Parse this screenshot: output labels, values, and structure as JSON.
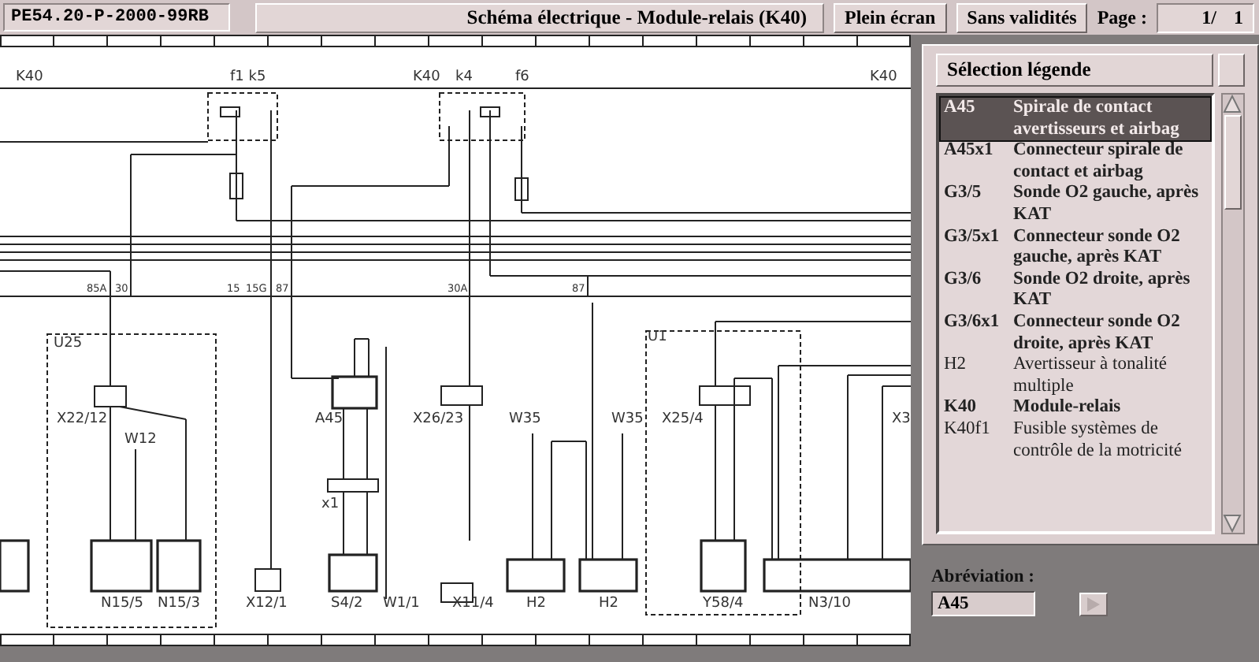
{
  "toolbar": {
    "document_id": "PE54.20-P-2000-99RB",
    "title": "Schéma électrique - Module-relais (K40)",
    "buttons": [
      "Plein écran",
      "Sans validités"
    ],
    "page_label": "Page :",
    "page_value": "1/ 1"
  },
  "diagram": {
    "labels": [
      "K40",
      "f1 k5",
      "K40",
      "k4",
      "f6",
      "K40",
      "85A",
      "30",
      "15",
      "15G",
      "87",
      "30A",
      "87",
      "U25",
      "X22/12",
      "W12",
      "N15/5",
      "N15/3",
      "X12/1",
      "A45",
      "x1",
      "S4/2",
      "W1/1",
      "X26/23",
      "X11/4",
      "W35",
      "W35",
      "H2",
      "H2",
      "U1",
      "X25/4",
      "Y58/4",
      "N3/10",
      "X3"
    ]
  },
  "legend": {
    "header": "Sélection légende",
    "items": [
      {
        "code": "A45",
        "description": "Spirale de contact avertisseurs et airbag",
        "selected": true,
        "bold": true
      },
      {
        "code": "A45x1",
        "description": "Connecteur spirale de contact et airbag",
        "selected": false,
        "bold": true
      },
      {
        "code": "G3/5",
        "description": "Sonde O2 gauche, après KAT",
        "selected": false,
        "bold": true
      },
      {
        "code": "G3/5x1",
        "description": "Connecteur sonde O2 gauche, après KAT",
        "selected": false,
        "bold": true
      },
      {
        "code": "G3/6",
        "description": "Sonde O2 droite, après KAT",
        "selected": false,
        "bold": true
      },
      {
        "code": "G3/6x1",
        "description": "Connecteur sonde O2 droite, après KAT",
        "selected": false,
        "bold": true
      },
      {
        "code": "H2",
        "description": "Avertisseur à tonalité multiple",
        "selected": false,
        "bold": false
      },
      {
        "code": "K40",
        "description": "Module-relais",
        "selected": false,
        "bold": true
      },
      {
        "code": "K40f1",
        "description": "Fusible systèmes de contrôle de la motricité",
        "selected": false,
        "bold": false
      }
    ]
  },
  "abbreviation": {
    "label": "Abréviation :",
    "value": "A45"
  }
}
